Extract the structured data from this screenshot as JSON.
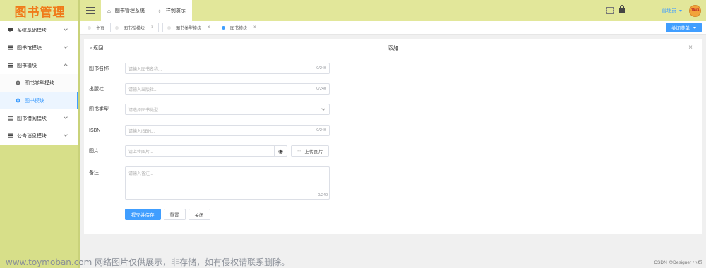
{
  "app": {
    "logo_text": "图书管理"
  },
  "sidebar": {
    "items": [
      {
        "label": "系统基础模块",
        "icon": "monitor-icon",
        "expanded": false
      },
      {
        "label": "图书馆模块",
        "icon": "list-icon",
        "expanded": false
      },
      {
        "label": "图书模块",
        "icon": "list-icon",
        "expanded": true
      },
      {
        "label": "图书类型模块",
        "icon": "gear-icon",
        "sub": true
      },
      {
        "label": "图书模块",
        "icon": "gear-icon",
        "sub": true,
        "active": true
      },
      {
        "label": "图书借阅模块",
        "icon": "list-icon",
        "expanded": false
      },
      {
        "label": "公告消息模块",
        "icon": "list-icon",
        "expanded": false
      }
    ]
  },
  "header": {
    "tabs": [
      {
        "label": "图书管理系统",
        "icon": "home-icon"
      },
      {
        "label": "样例演示",
        "icon": "bulb-icon"
      }
    ],
    "user": "管理员",
    "avatar_text": "JAVA"
  },
  "page_tabs": {
    "items": [
      {
        "label": "主页",
        "closable": false
      },
      {
        "label": "图书馆模块",
        "closable": true
      },
      {
        "label": "图书类型模块",
        "closable": true
      },
      {
        "label": "图书模块",
        "closable": true,
        "active": true
      }
    ],
    "close_menu_label": "关闭菜单"
  },
  "form": {
    "back_label": "返回",
    "title": "添加",
    "fields": {
      "name": {
        "label": "图书名称",
        "placeholder": "请输入图书名称...",
        "count": "0/240"
      },
      "publisher": {
        "label": "出版社",
        "placeholder": "请输入出版社...",
        "count": "0/240"
      },
      "type": {
        "label": "图书类型",
        "placeholder": "请选择图书类型..."
      },
      "isbn": {
        "label": "ISBN",
        "placeholder": "请输入ISBN...",
        "count": "0/240"
      },
      "image": {
        "label": "图片",
        "placeholder": "请上传图片...",
        "upload_label": "上传图片"
      },
      "remark": {
        "label": "备注",
        "placeholder": "请输入备注...",
        "count": "0/240"
      }
    },
    "buttons": {
      "submit": "提交并保存",
      "reset": "重置",
      "close": "关闭"
    }
  },
  "footer": {
    "watermark": "www.toymoban.com 网络图片仅供展示，非存储，如有侵权请联系删除。",
    "credit": "CSDN @Designer 小郑"
  },
  "colors": {
    "accent": "#409eff",
    "logo": "#f07a19",
    "background": "#e9ec9a"
  }
}
